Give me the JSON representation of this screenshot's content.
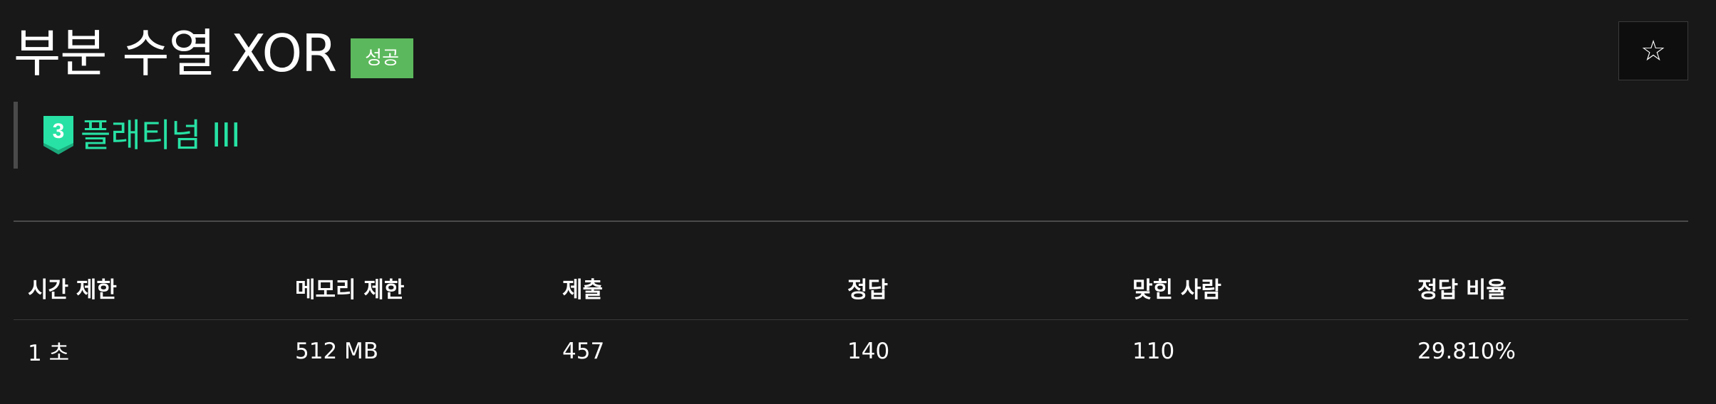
{
  "problem": {
    "title": "부분 수열 XOR",
    "status_badge": "성공",
    "tier": {
      "number": "3",
      "label": "플래티넘 III",
      "color": "#27e2a4"
    }
  },
  "actions": {
    "favorite_icon": "☆"
  },
  "info_table": {
    "headers": [
      "시간 제한",
      "메모리 제한",
      "제출",
      "정답",
      "맞힌 사람",
      "정답 비율"
    ],
    "values": [
      "1 초",
      "512 MB",
      "457",
      "140",
      "110",
      "29.810%"
    ]
  },
  "colors": {
    "background": "#181818",
    "success_badge": "#5cb85c",
    "platinum": "#27e2a4"
  }
}
